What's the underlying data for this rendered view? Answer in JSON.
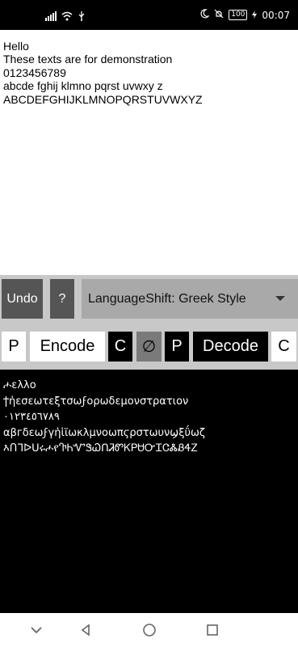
{
  "status_bar": {
    "time": "00:07",
    "battery_level": "100"
  },
  "input": {
    "text": "Hello\nThese texts are for demonstration\n0123456789\nabcde fghij klmno pqrst uvwxy z\nABCDEFGHIJKLMNOPQRSTUVWXYZ"
  },
  "controls": {
    "undo_label": "Undo",
    "help_label": "?",
    "language_selected": "LanguageShift: Greek Style",
    "tiles": {
      "p_left": "P",
      "encode": "Encode",
      "c_left": "C",
      "empty_symbol": "∅",
      "p_right": "P",
      "decode": "Decode",
      "c_right": "C"
    }
  },
  "output": {
    "text": "ሖελλο\nϯἡεσεωτεξτσωϝορωδεμονστρατιον\n٠١٢٣٤٥٦٧٨٩\nαβгδεωϝγἡἱϊωκλμνοωπϛρστωυνϣξΰωζ\nእՈᒣᐅᑌሩሖየႥᏂᏉᏕᏇᑎᏘᏛᏦᏢᏌᏅᏆᏣᏜᏰᏎᏃ"
  },
  "colors": {
    "status_bar_bg": "#000000",
    "controls_bg": "#c8c8c8",
    "dark_button": "#555555",
    "dropdown_bg": "#a9a9a9",
    "output_bg": "#000000"
  }
}
